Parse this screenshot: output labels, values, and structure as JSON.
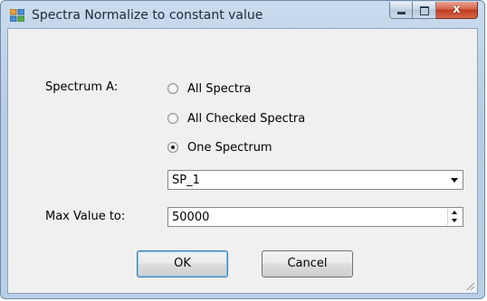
{
  "window": {
    "title": "Spectra Normalize to constant value",
    "close_glyph": "x",
    "icons": {
      "app": "app-icon",
      "minimize": "minimize-icon",
      "maximize": "maximize-icon",
      "close": "close-icon"
    },
    "accent_color": "#c23b1f"
  },
  "form": {
    "spectrum_label": "Spectrum A:",
    "options": [
      {
        "label": "All Spectra",
        "selected": false
      },
      {
        "label": "All Checked Spectra",
        "selected": false
      },
      {
        "label": "One Spectrum",
        "selected": true
      }
    ],
    "spectrum_select": {
      "value": "SP_1"
    },
    "max_value_label": "Max Value to:",
    "max_value": "50000"
  },
  "buttons": {
    "ok": "OK",
    "cancel": "Cancel"
  }
}
